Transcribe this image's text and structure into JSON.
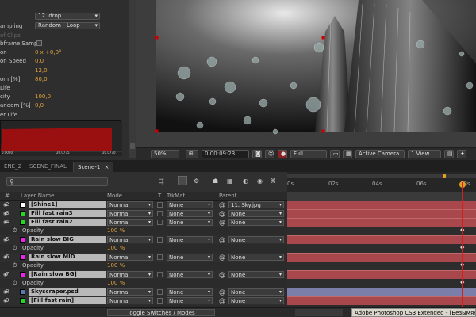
{
  "effects": {
    "dropdown1": "12. drop",
    "sampling_label": "ampling",
    "sampling_value": "Random - Loop",
    "frame_label": "of Clips",
    "subframe_label": "bframe Samp",
    "rot_label": "on",
    "rot_value": "0 x +0,0°",
    "speed_label": "on Speed",
    "speed_value": "0,0",
    "v12": "12,0",
    "rand_label": "om [%]",
    "rand_value": "80,0",
    "life_label": "Life",
    "city_label": "city",
    "city_value": "100,0",
    "andom_label": "andom [%]",
    "andom_value": "0,0",
    "overlife_label": "er Life",
    "graph_left": "0.0000",
    "graph_mid": "20.0775",
    "graph_right": "20.0770"
  },
  "viewer": {
    "zoom": "50%",
    "timecode": "0:00:09:23",
    "res": "Full",
    "camera": "Active Camera",
    "views": "1 View"
  },
  "tabs": [
    "ENE_2",
    "SCENE_FINAL",
    "Scene-1"
  ],
  "ruler": [
    "0s",
    "02s",
    "04s",
    "06s",
    "08s"
  ],
  "headers": {
    "num": "#",
    "layer": "Layer Name",
    "mode": "Mode",
    "t": "T",
    "trkmat": "TrkMat",
    "parent": "Parent"
  },
  "layers": [
    {
      "n": "2",
      "name": "[Shine1]",
      "color": "#ffffff",
      "mode": "Normal",
      "trk": "None",
      "parent": "11. Sky.jpg",
      "type": "layer"
    },
    {
      "n": "3",
      "name": "Fill fast rain3",
      "color": "#22d822",
      "mode": "Normal",
      "trk": "None",
      "parent": "None",
      "type": "layer"
    },
    {
      "n": "4",
      "name": "Fill fast rain2",
      "color": "#22d822",
      "mode": "Normal",
      "trk": "None",
      "parent": "None",
      "type": "layer"
    },
    {
      "name": "Opacity",
      "value": "100 %",
      "type": "prop"
    },
    {
      "n": "5",
      "name": "Rain slow BIG",
      "color": "#ee22ee",
      "mode": "Normal",
      "trk": "None",
      "parent": "None",
      "type": "layer"
    },
    {
      "name": "Opacity",
      "value": "100 %",
      "type": "prop"
    },
    {
      "n": "6",
      "name": "Rain slow MID",
      "color": "#ee22ee",
      "mode": "Normal",
      "trk": "None",
      "parent": "None",
      "type": "layer"
    },
    {
      "name": "Opacity",
      "value": "100 %",
      "type": "prop"
    },
    {
      "n": "7",
      "name": "[Rain slow BG]",
      "color": "#ee22ee",
      "mode": "Normal",
      "trk": "None",
      "parent": "None",
      "type": "layer"
    },
    {
      "name": "Opacity",
      "value": "100 %",
      "type": "prop"
    },
    {
      "n": "8",
      "name": "Skyscraper.psd",
      "color": "#5a7ab5",
      "mode": "Normal",
      "trk": "None",
      "parent": "None",
      "type": "layer"
    },
    {
      "n": "9",
      "name": "[Fill fast rain]",
      "color": "#22d822",
      "mode": "Normal",
      "trk": "None",
      "parent": "None",
      "type": "layer"
    }
  ],
  "footer": {
    "toggle": "Toggle Switches / Modes"
  },
  "taskbar": "Adobe Photoshop CS3 Extended - [Безымянн-2 @"
}
